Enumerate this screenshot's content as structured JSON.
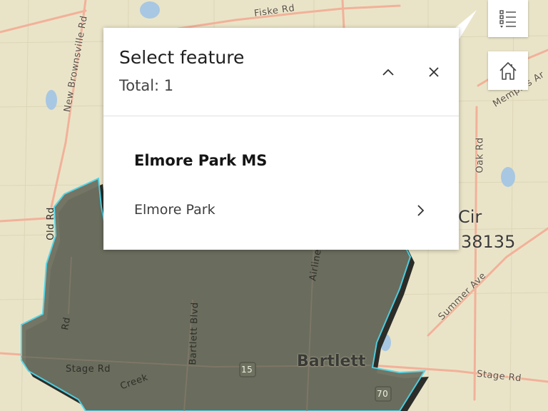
{
  "map": {
    "road_labels": {
      "fiske_rd": "Fiske Rd",
      "new_brownsville_rd": "New Brownsville Rd",
      "oak_rd": "Oak Rd",
      "memphis_ar": "Memphis Ar",
      "summer_ave": "Summer Ave",
      "stage_rd_east": "Stage Rd",
      "stage_rd_west": "Stage Rd",
      "bartlett_blvd": "Bartlett Blvd",
      "creek": "Creek",
      "airline": "Airline",
      "rd_west": "Rd",
      "old_rd": "Old Rd",
      "hwy_15": "15",
      "hwy_70": "70"
    },
    "place_labels": {
      "bartlett": "Bartlett",
      "cir": "Cir",
      "zip": "38135"
    },
    "colors": {
      "base": "#e9e4c8",
      "road": "#f2b199",
      "district_fill": "#6e7060",
      "district_outline": "#4fd5e8",
      "water": "#a8c7e2"
    }
  },
  "widgets": {
    "layer_list_icon": "list-icon",
    "home_icon": "home-icon"
  },
  "popup": {
    "title": "Select feature",
    "total": "Total: 1",
    "collapse_icon": "chevron-up-icon",
    "close_icon": "close-icon",
    "feature": {
      "title": "Elmore Park MS",
      "subtitle": "Elmore Park",
      "chevron_icon": "chevron-right-icon"
    }
  }
}
